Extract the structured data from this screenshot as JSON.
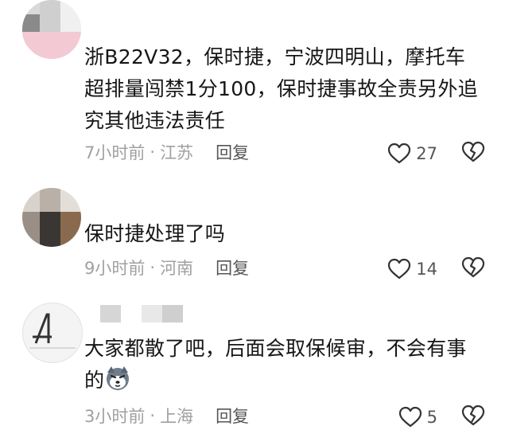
{
  "comments": [
    {
      "text": "浙B22V32，保时捷，宁波四明山，摩托车超排量闯禁1分100，保时捷事故全责另外追究其他违法责任",
      "time": "7小时前",
      "sep": "·",
      "location": "江苏",
      "reply_label": "回复",
      "likes": "27"
    },
    {
      "text": "保时捷处理了吗",
      "time": "9小时前",
      "sep": "·",
      "location": "河南",
      "reply_label": "回复",
      "likes": "14"
    },
    {
      "text": "大家都散了吧，后面会取保候审，不会有事的",
      "time": "3小时前",
      "sep": "·",
      "location": "上海",
      "reply_label": "回复",
      "likes": "5",
      "emoji": "husky-dog-emoji"
    }
  ],
  "icons": {
    "like": "heart-outline-icon",
    "dislike": "broken-heart-icon"
  },
  "colors": {
    "text": "#161616",
    "meta": "#9a9a9a",
    "reply": "#555555",
    "icon": "#333333"
  }
}
